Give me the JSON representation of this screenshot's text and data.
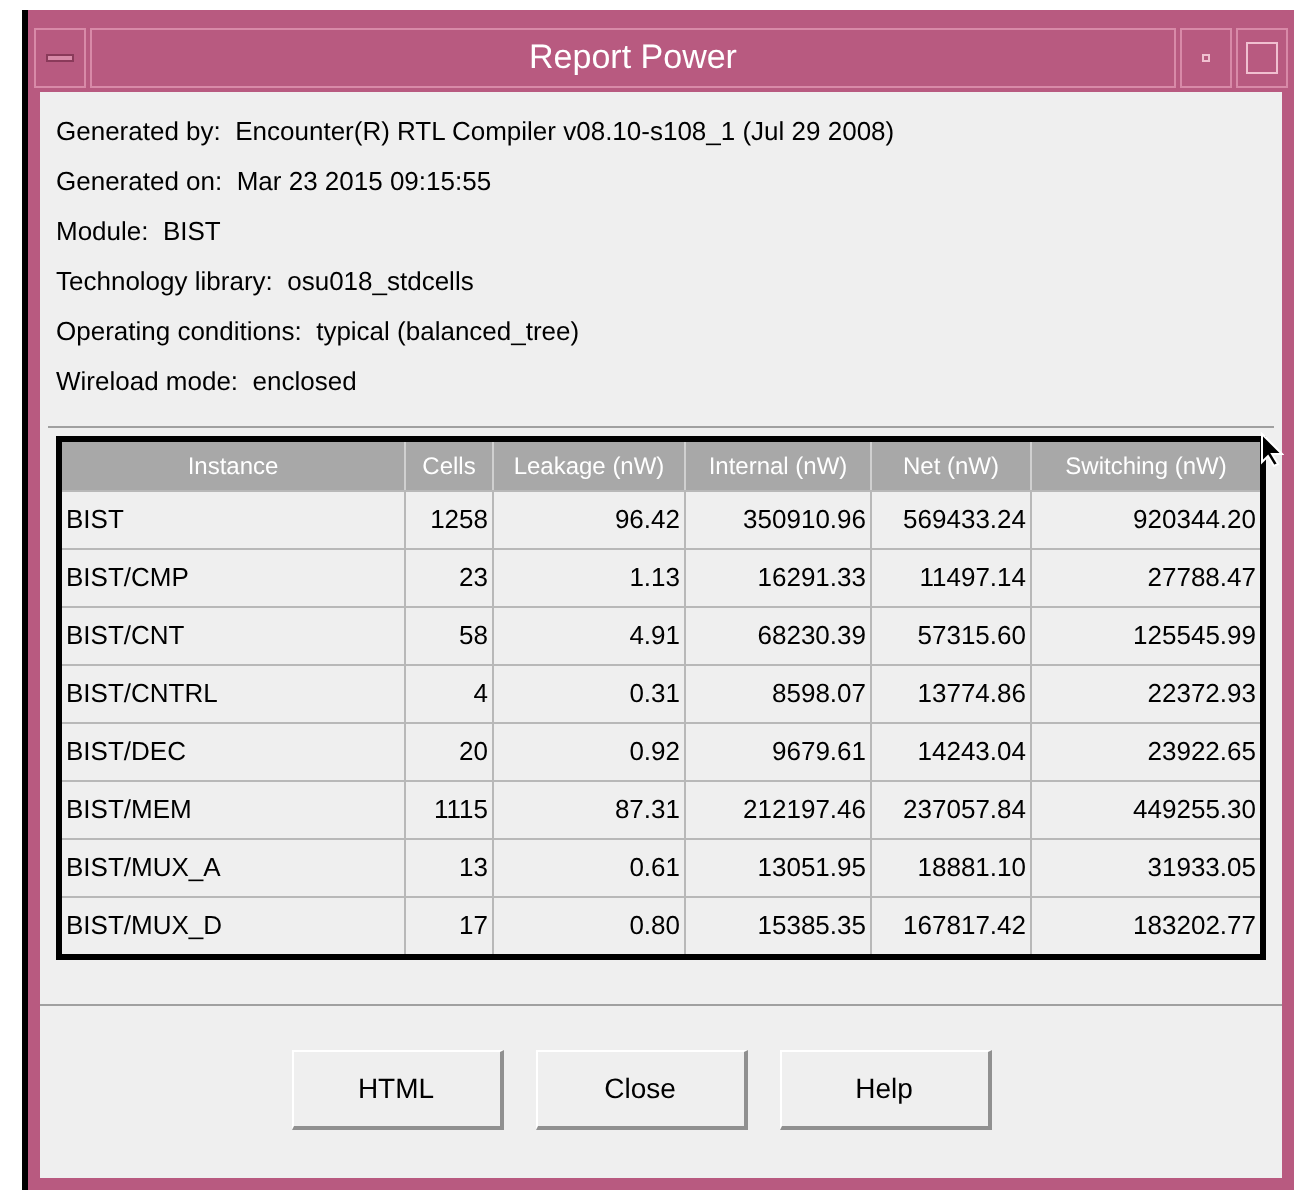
{
  "window": {
    "title": "Report Power"
  },
  "info_lines": [
    "Generated by:  Encounter(R) RTL Compiler v08.10-s108_1 (Jul 29 2008)",
    "Generated on:  Mar 23 2015 09:15:55",
    "Module:  BIST",
    "Technology library:  osu018_stdcells",
    "Operating conditions:  typical (balanced_tree)",
    "Wireload mode:  enclosed"
  ],
  "table": {
    "columns": [
      "Instance",
      "Cells",
      "Leakage (nW)",
      "Internal (nW)",
      "Net (nW)",
      "Switching (nW)"
    ],
    "rows": [
      [
        "BIST",
        "1258",
        "96.42",
        "350910.96",
        "569433.24",
        "920344.20"
      ],
      [
        "BIST/CMP",
        "23",
        "1.13",
        "16291.33",
        "11497.14",
        "27788.47"
      ],
      [
        "BIST/CNT",
        "58",
        "4.91",
        "68230.39",
        "57315.60",
        "125545.99"
      ],
      [
        "BIST/CNTRL",
        "4",
        "0.31",
        "8598.07",
        "13774.86",
        "22372.93"
      ],
      [
        "BIST/DEC",
        "20",
        "0.92",
        "9679.61",
        "14243.04",
        "23922.65"
      ],
      [
        "BIST/MEM",
        "1115",
        "87.31",
        "212197.46",
        "237057.84",
        "449255.30"
      ],
      [
        "BIST/MUX_A",
        "13",
        "0.61",
        "13051.95",
        "18881.10",
        "31933.05"
      ],
      [
        "BIST/MUX_D",
        "17",
        "0.80",
        "15385.35",
        "167817.42",
        "183202.77"
      ]
    ]
  },
  "buttons": [
    "HTML",
    "Close",
    "Help"
  ]
}
